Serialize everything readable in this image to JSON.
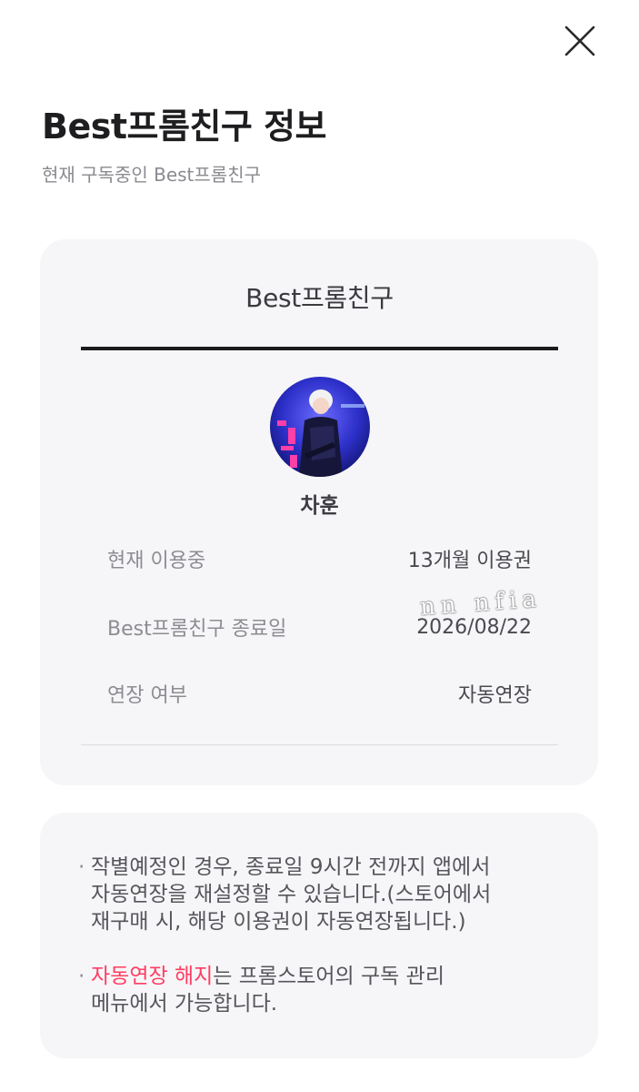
{
  "header": {
    "close_icon": "close-icon",
    "title": "Best프롬친구 정보",
    "subtitle": "현재 구독중인 Best프롬친구"
  },
  "subscription_card": {
    "title": "Best프롬친구",
    "avatar_icon": "artist-avatar",
    "artist_name": "차훈",
    "rows": [
      {
        "label": "현재 이용중",
        "value": "13개월 이용권"
      },
      {
        "label": "Best프롬친구 종료일",
        "value": "2026/08/22"
      },
      {
        "label": "연장 여부",
        "value": "자동연장"
      }
    ],
    "watermark": "nn nfia"
  },
  "notices": {
    "bullet": "·",
    "item1": {
      "lines": [
        "작별예정인 경우, 종료일 9시간 전까지 앱에서",
        "자동연장을 재설정할 수 있습니다.(스토어에서",
        "재구매 시, 해당 이용권이 자동연장됩니다.)"
      ]
    },
    "item2": {
      "highlight": "자동연장 해지",
      "line1_rest": "는 프롬스토어의 구독 관리",
      "line2": "메뉴에서 가능합니다."
    }
  },
  "colors": {
    "accent": "#ff3d62",
    "card_background": "#f6f6f8",
    "title_rule": "#1b1b1d"
  }
}
